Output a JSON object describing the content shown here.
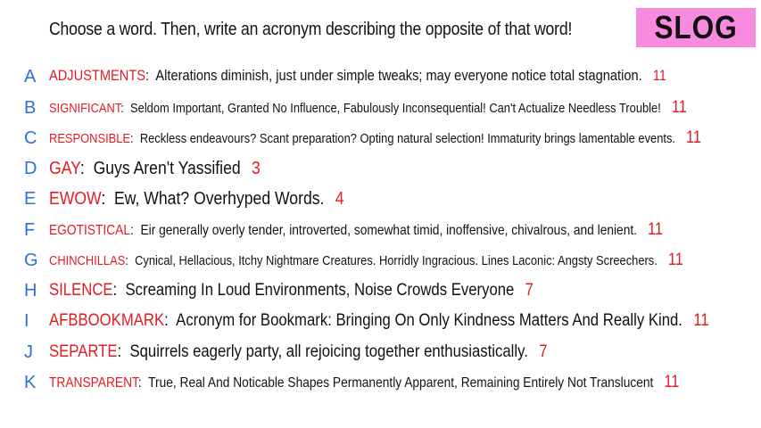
{
  "prompt": "Choose a word. Then, write an acronym describing the opposite of that word!",
  "badge": {
    "label": "SLOG",
    "color": "#f78be0"
  },
  "colors": {
    "letter": "#2f6fd6",
    "word": "#e31b23",
    "count": "#e31b23",
    "text": "#111111"
  },
  "entries": [
    {
      "letter": "A",
      "word": "ADJUSTMENTS",
      "definition": "Alterations diminish, just under simple tweaks; may everyone notice total stagnation.",
      "count": "11"
    },
    {
      "letter": "B",
      "word": "SIGNIFICANT",
      "definition": "Seldom Important, Granted No Influence, Fabulously Inconsequential! Can't Actualize Needless Trouble!",
      "count": "11"
    },
    {
      "letter": "C",
      "word": "RESPONSIBLE",
      "definition": "Reckless endeavours? Scant preparation? Opting natural selection! Immaturity brings lamentable events.",
      "count": "11"
    },
    {
      "letter": "D",
      "word": "GAY",
      "definition": "Guys Aren't Yassified",
      "count": "3"
    },
    {
      "letter": "E",
      "word": "EWOW",
      "definition": "Ew, What? Overhyped Words.",
      "count": "4"
    },
    {
      "letter": "F",
      "word": "EGOTISTICAL",
      "definition": "Eir generally overly tender, introverted, somewhat timid, inoffensive, chivalrous, and lenient.",
      "count": "11"
    },
    {
      "letter": "G",
      "word": "CHINCHILLAS",
      "definition": "Cynical, Hellacious, Itchy Nightmare Creatures. Horridly Ingracious. Lines Laconic: Angsty Screechers.",
      "count": "11"
    },
    {
      "letter": "H",
      "word": "SILENCE",
      "definition": "Screaming In Loud Environments, Noise Crowds Everyone",
      "count": "7"
    },
    {
      "letter": "I",
      "word": "AFBBOOKMARK",
      "definition": "Acronym for Bookmark: Bringing On Only Kindness Matters And Really Kind.",
      "count": "11"
    },
    {
      "letter": "J",
      "word": "SEPARTE",
      "definition": "Squirrels eagerly party, all rejoicing together enthusiastically.",
      "count": "7"
    },
    {
      "letter": "K",
      "word": "TRANSPARENT",
      "definition": "True, Real And Noticable Shapes Permanently Apparent, Remaining Entirely Not Translucent",
      "count": "11"
    }
  ]
}
